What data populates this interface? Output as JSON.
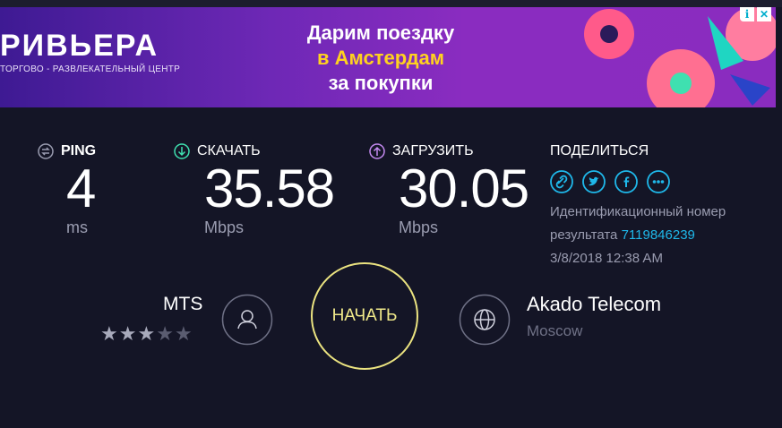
{
  "ad": {
    "brand": "РИВЬЕРА",
    "brand_sub": "ТОРГОВО - РАЗВЛЕКАТЕЛЬНЫЙ ЦЕНТР",
    "line1": "Дарим поездку",
    "line2": "в Амстердам",
    "line3": "за покупки",
    "info_icon": "i",
    "close_icon": "✕"
  },
  "metrics": {
    "ping": {
      "label": "PING",
      "value": "4",
      "unit": "ms"
    },
    "download": {
      "label": "СКАЧАТЬ",
      "value": "35.58",
      "unit": "Mbps"
    },
    "upload": {
      "label": "ЗАГРУЗИТЬ",
      "value": "30.05",
      "unit": "Mbps"
    }
  },
  "share": {
    "label": "ПОДЕЛИТЬСЯ",
    "icons": [
      "link-icon",
      "twitter-icon",
      "facebook-icon",
      "more-icon"
    ],
    "result_label_1": "Идентификационный номер",
    "result_label_2": "результата",
    "result_id": "7119846239",
    "datetime": "3/8/2018 12:38 AM"
  },
  "isp": {
    "name": "MTS",
    "rating": 3,
    "max_rating": 5
  },
  "go_button": {
    "label": "НАЧАТЬ"
  },
  "server": {
    "name": "Akado Telecom",
    "location": "Moscow"
  },
  "colors": {
    "background": "#141526",
    "accent_teal": "#1fb8ea",
    "accent_yellow": "#ebe380",
    "muted": "#9a9cb0"
  }
}
